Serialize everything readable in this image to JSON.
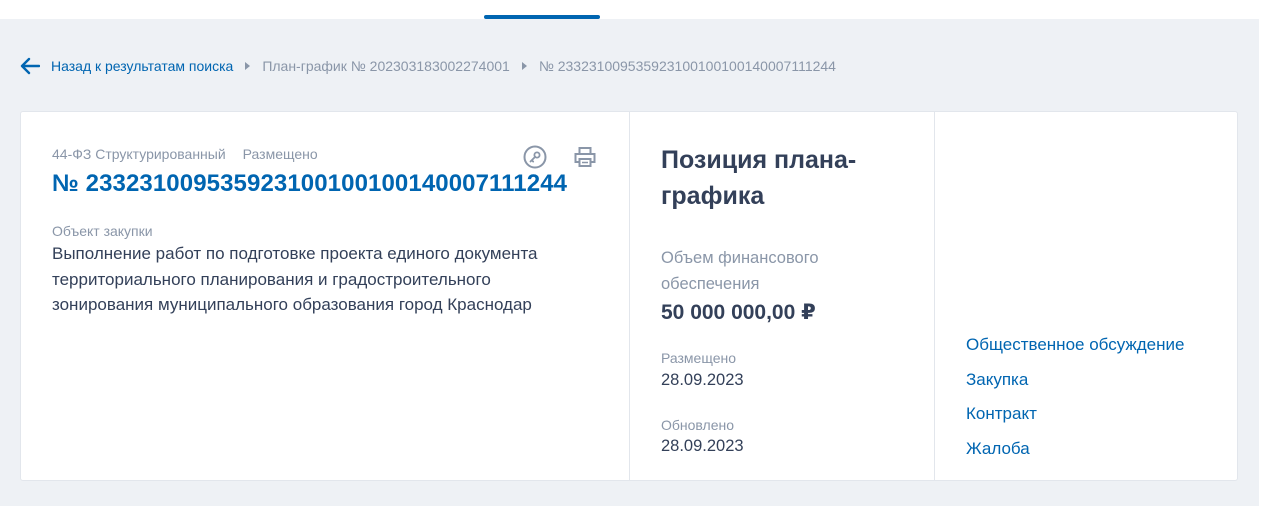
{
  "breadcrumb": {
    "back_label": "Назад к результатам поиска",
    "plan": "План-график № 202303183002274001",
    "position": "№ 233231009535923100100100140007111244"
  },
  "card": {
    "law_type": "44-ФЗ Структурированный",
    "status": "Размещено",
    "number": "№ 233231009535923100100100140007111244",
    "object_label": "Объект закупки",
    "object_text": "Выполнение работ по подготовке проекта единого документа территориального планирования и градостроительного зонирования муниципального образования город Краснодар",
    "icons": {
      "key": "key-circle-icon",
      "print": "printer-icon"
    }
  },
  "info": {
    "title": "Позиция плана-графика",
    "finance_label": "Объем финансового обеспечения",
    "finance_value": "50 000 000,00 ₽",
    "placed_label": "Размещено",
    "placed_date": "28.09.2023",
    "updated_label": "Обновлено",
    "updated_date": "28.09.2023"
  },
  "links": [
    {
      "label": "Общественное обсуждение"
    },
    {
      "label": "Закупка"
    },
    {
      "label": "Контракт"
    },
    {
      "label": "Жалоба"
    }
  ],
  "colors": {
    "accent": "#0065b1",
    "text": "#334059",
    "muted": "#8a96a8",
    "background": "#eef1f5"
  }
}
